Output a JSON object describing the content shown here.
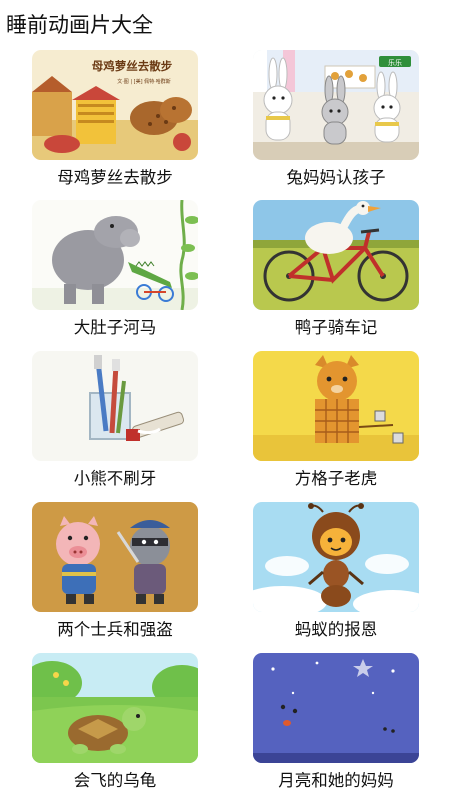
{
  "header": {
    "title": "睡前动画片大全"
  },
  "items": [
    {
      "title": "母鸡萝丝去散步",
      "cover_text": "母鸡萝丝去散步",
      "cover_subtext": "文·图 | [美] 佩特·哈群斯",
      "illustration": "hen-farmyard-illustration"
    },
    {
      "title": "兔妈妈认孩子",
      "cover_badge": "乐乐",
      "illustration": "rabbits-shop-illustration"
    },
    {
      "title": "大肚子河马",
      "illustration": "hippo-crocodile-illustration"
    },
    {
      "title": "鸭子骑车记",
      "illustration": "duck-bicycle-illustration"
    },
    {
      "title": "小熊不刷牙",
      "illustration": "toothbrush-cup-illustration"
    },
    {
      "title": "方格子老虎",
      "illustration": "checkered-tiger-illustration"
    },
    {
      "title": "两个士兵和强盗",
      "illustration": "pig-soldier-raccoon-illustration"
    },
    {
      "title": "蚂蚁的报恩",
      "illustration": "ant-flying-illustration"
    },
    {
      "title": "会飞的乌龟",
      "illustration": "turtle-meadow-illustration"
    },
    {
      "title": "月亮和她的妈妈",
      "illustration": "moons-night-illustration"
    }
  ]
}
